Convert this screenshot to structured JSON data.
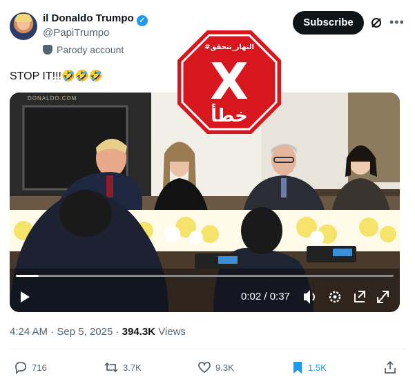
{
  "author": {
    "display_name": "il Donaldo Trumpo",
    "handle": "@PapiTrumpo",
    "label": "Parody account",
    "verified_icon": "verified-badge-icon"
  },
  "header": {
    "subscribe_label": "Subscribe"
  },
  "tweet": {
    "text": "STOP IT!!!🤣🤣🤣"
  },
  "stamp": {
    "hashtag": "#النهار_تتحقق",
    "mark": "X",
    "word": "خطأ"
  },
  "video": {
    "watermark": "DONALDO.COM",
    "current_time": "0:02",
    "duration": "0:37",
    "time_display": "0:02 / 0:37",
    "progress": 0.06
  },
  "meta": {
    "time": "4:24 AM",
    "date": "Sep 5, 2025",
    "views_count": "394.3K",
    "views_label": "Views",
    "separator": "·"
  },
  "actions": {
    "replies": "716",
    "reposts": "3.7K",
    "likes": "9.3K",
    "bookmarks": "1.5K"
  },
  "colors": {
    "accent": "#1d9bf0",
    "stamp_red": "#d7161d",
    "text_primary": "#0f1419",
    "text_secondary": "#536471"
  }
}
